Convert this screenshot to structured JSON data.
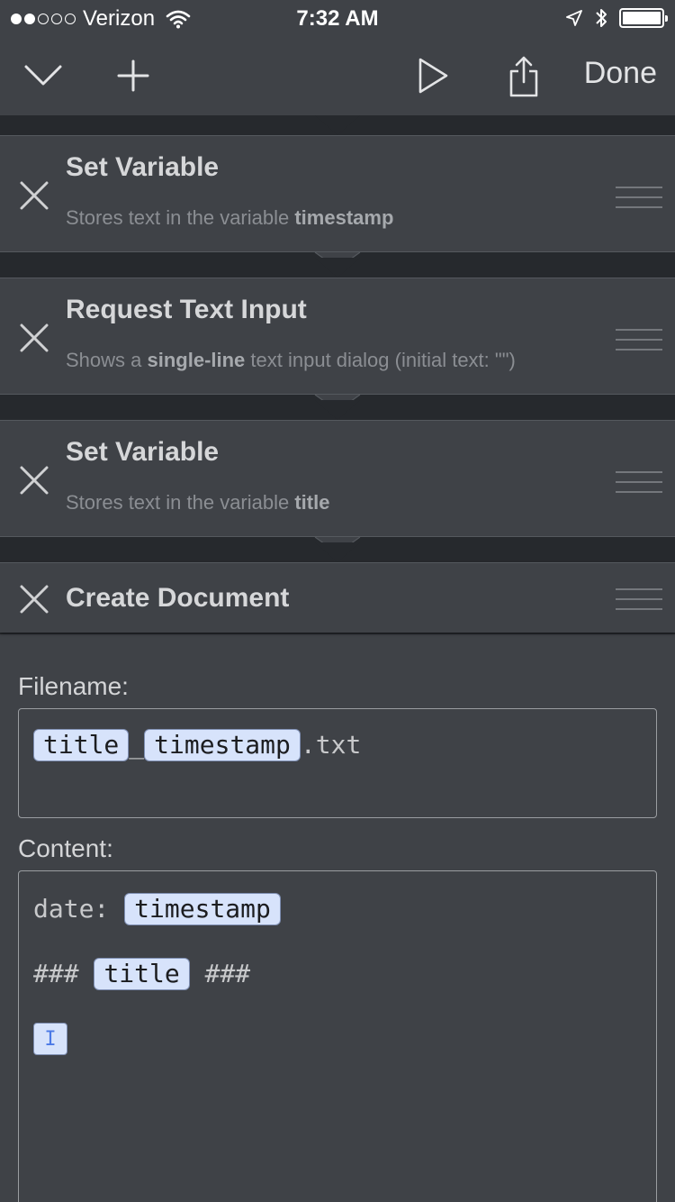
{
  "status_bar": {
    "carrier": "Verizon",
    "signal_bars_filled": 2,
    "signal_bars_total": 5,
    "time": "7:32 AM",
    "battery_level": 1.0
  },
  "nav": {
    "done_label": "Done",
    "icons": [
      "chevron-down-icon",
      "plus-icon",
      "play-icon",
      "share-icon"
    ]
  },
  "actions": [
    {
      "title": "Set Variable",
      "desc_prefix": "Stores text in the variable ",
      "desc_bold": "timestamp",
      "desc_suffix": ""
    },
    {
      "title": "Request Text Input",
      "desc_prefix": "Shows a ",
      "desc_bold": "single-line",
      "desc_suffix": " text input dialog (initial text: \"\")"
    },
    {
      "title": "Set Variable",
      "desc_prefix": "Stores text in the variable ",
      "desc_bold": "title",
      "desc_suffix": ""
    },
    {
      "title": "Create Document"
    }
  ],
  "document": {
    "filename_label": "Filename:",
    "filename": {
      "token1": "title",
      "separator": "_",
      "token2": "timestamp",
      "extension": ".txt"
    },
    "content_label": "Content:",
    "content": {
      "line1_prefix": "date: ",
      "line1_token": "timestamp",
      "line2_prefix": "### ",
      "line2_token": "title",
      "line2_suffix": " ###",
      "cursor_glyph": "I"
    }
  },
  "colors": {
    "background": "#3f4247",
    "list_background": "#26292d",
    "token_fill": "#d7e3fb",
    "cursor_blue": "#4b79e6"
  }
}
